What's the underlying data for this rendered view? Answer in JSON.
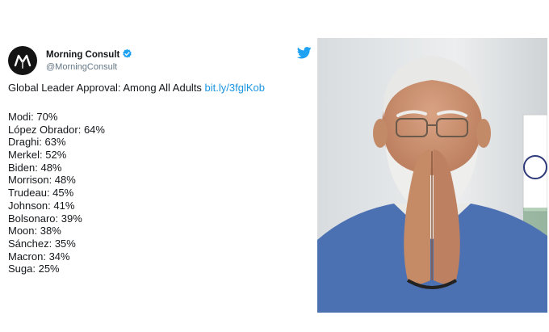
{
  "account": {
    "name": "Morning Consult",
    "handle": "@MorningConsult",
    "avatar_icon": "morning-consult-logo",
    "verified_icon": "verified-badge-icon",
    "brand_icon": "twitter-bird-icon"
  },
  "tweet": {
    "text": "Global Leader Approval: Among All Adults ",
    "link": "bit.ly/3fglKob"
  },
  "approval": [
    {
      "label": "Modi: 70%"
    },
    {
      "label": "López Obrador: 64%"
    },
    {
      "label": "Draghi: 63%"
    },
    {
      "label": "Merkel: 52%"
    },
    {
      "label": "Biden: 48%"
    },
    {
      "label": "Morrison: 48%"
    },
    {
      "label": "Trudeau: 45%"
    },
    {
      "label": "Johnson: 41%"
    },
    {
      "label": "Bolsonaro: 39%"
    },
    {
      "label": "Moon: 38%"
    },
    {
      "label": "Sánchez: 35%"
    },
    {
      "label": "Macron: 34%"
    },
    {
      "label": "Suga: 25%"
    }
  ],
  "colors": {
    "twitter_blue": "#1da1f2",
    "link_blue": "#1b95e0",
    "text": "#14171a",
    "secondary_text": "#657786"
  }
}
